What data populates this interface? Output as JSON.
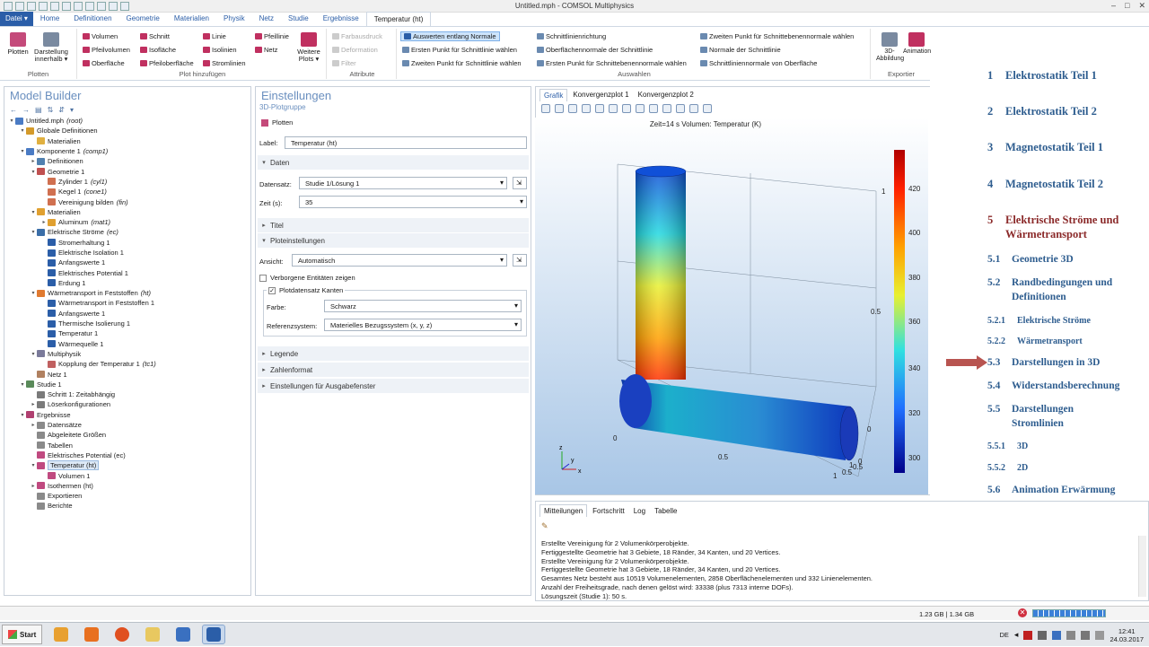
{
  "window": {
    "title": "Untitled.mph - COMSOL Multiphysics"
  },
  "menu": {
    "file": "Datei ▾",
    "tabs": [
      "Home",
      "Definitionen",
      "Geometrie",
      "Materialien",
      "Physik",
      "Netz",
      "Studie",
      "Ergebnisse",
      "Temperatur (ht)"
    ]
  },
  "ribbon": {
    "plot_btn": "Plotten",
    "layout_btn_1": "Darstellung",
    "layout_btn_2": "innerhalb ▾",
    "group_plot": "Plotten",
    "add": {
      "c1": [
        "Volumen",
        "Pfeilvolumen",
        "Oberfläche"
      ],
      "c2": [
        "Schnitt",
        "Isofläche",
        "Pfeiloberfläche"
      ],
      "c3": [
        "Linie",
        "Isolinien",
        "Stromlinien"
      ],
      "c4": [
        "Pfeillinie",
        "Netz"
      ],
      "more_1": "Weitere",
      "more_2": "Plots ▾",
      "label": "Plot hinzufügen"
    },
    "attr": {
      "items": [
        "Farbausdruck",
        "Deformation",
        "Filter"
      ],
      "label": "Attribute"
    },
    "sel": {
      "c1": [
        "Auswerten entlang Normale",
        "Ersten Punkt für Schnittlinie wählen",
        "Zweiten Punkt für Schnittlinie wählen"
      ],
      "c2": [
        "Schnittlinienrichtung",
        "Oberflächennormale der Schnittlinie",
        "Ersten Punkt für Schnittebenennormale wählen"
      ],
      "c3": [
        "Zweiten Punkt für Schnittebenennormale wählen",
        "Normale der Schnittlinie",
        "Schnittliniennormale von Oberfläche"
      ],
      "label": "Auswahlen"
    },
    "export": {
      "b1": "3D-Abbildung",
      "b2": "Animation",
      "label": "Exportier"
    }
  },
  "model_builder": {
    "title": "Model Builder",
    "tree": [
      {
        "d": 0,
        "t": "▾",
        "c": "#4a7bc4",
        "l": "Untitled.mph",
        "i": "(root)"
      },
      {
        "d": 1,
        "t": "▾",
        "c": "#d49a2a",
        "l": "Globale Definitionen"
      },
      {
        "d": 2,
        "t": "",
        "c": "#e0b040",
        "l": "Materialien"
      },
      {
        "d": 1,
        "t": "▾",
        "c": "#4a7bc4",
        "l": "Komponente 1",
        "i": "(comp1)"
      },
      {
        "d": 2,
        "t": "▸",
        "c": "#5080b0",
        "l": "Definitionen"
      },
      {
        "d": 2,
        "t": "▾",
        "c": "#c05050",
        "l": "Geometrie 1"
      },
      {
        "d": 3,
        "t": "",
        "c": "#d07050",
        "l": "Zylinder 1",
        "i": "(cyl1)"
      },
      {
        "d": 3,
        "t": "",
        "c": "#d07050",
        "l": "Kegel 1",
        "i": "(cone1)"
      },
      {
        "d": 3,
        "t": "",
        "c": "#d07050",
        "l": "Vereinigung bilden",
        "i": "(fin)"
      },
      {
        "d": 2,
        "t": "▾",
        "c": "#e0a030",
        "l": "Materialien"
      },
      {
        "d": 3,
        "t": "▸",
        "c": "#e0a030",
        "l": "Aluminum",
        "i": "(mat1)"
      },
      {
        "d": 2,
        "t": "▾",
        "c": "#3a6ea8",
        "l": "Elektrische Ströme",
        "i": "(ec)"
      },
      {
        "d": 3,
        "t": "",
        "c": "#2b5ea8",
        "l": "Stromerhaltung 1"
      },
      {
        "d": 3,
        "t": "",
        "c": "#2b5ea8",
        "l": "Elektrische Isolation 1"
      },
      {
        "d": 3,
        "t": "",
        "c": "#2b5ea8",
        "l": "Anfangswerte 1"
      },
      {
        "d": 3,
        "t": "",
        "c": "#2b5ea8",
        "l": "Elektrisches Potential 1"
      },
      {
        "d": 3,
        "t": "",
        "c": "#2b5ea8",
        "l": "Erdung 1"
      },
      {
        "d": 2,
        "t": "▾",
        "c": "#e07a30",
        "l": "Wärmetransport in Feststoffen",
        "i": "(ht)"
      },
      {
        "d": 3,
        "t": "",
        "c": "#2b5ea8",
        "l": "Wärmetransport in Feststoffen 1"
      },
      {
        "d": 3,
        "t": "",
        "c": "#2b5ea8",
        "l": "Anfangswerte 1"
      },
      {
        "d": 3,
        "t": "",
        "c": "#2b5ea8",
        "l": "Thermische Isolierung 1"
      },
      {
        "d": 3,
        "t": "",
        "c": "#2b5ea8",
        "l": "Temperatur 1"
      },
      {
        "d": 3,
        "t": "",
        "c": "#2b5ea8",
        "l": "Wärmequelle 1"
      },
      {
        "d": 2,
        "t": "▾",
        "c": "#7a7a9a",
        "l": "Multiphysik"
      },
      {
        "d": 3,
        "t": "",
        "c": "#c06060",
        "l": "Kopplung der Temperatur 1",
        "i": "(tc1)"
      },
      {
        "d": 2,
        "t": "",
        "c": "#b08060",
        "l": "Netz 1"
      },
      {
        "d": 1,
        "t": "▾",
        "c": "#5a8a5a",
        "l": "Studie 1"
      },
      {
        "d": 2,
        "t": "",
        "c": "#7a7a7a",
        "l": "Schritt 1: Zeitabhängig"
      },
      {
        "d": 2,
        "t": "▸",
        "c": "#7a7a7a",
        "l": "Löserkonfigurationen"
      },
      {
        "d": 1,
        "t": "▾",
        "c": "#b04070",
        "l": "Ergebnisse"
      },
      {
        "d": 2,
        "t": "▸",
        "c": "#8a8a8a",
        "l": "Datensätze"
      },
      {
        "d": 2,
        "t": "",
        "c": "#8a8a8a",
        "l": "Abgeleitete Größen"
      },
      {
        "d": 2,
        "t": "",
        "c": "#8a8a8a",
        "l": "Tabellen"
      },
      {
        "d": 2,
        "t": "",
        "c": "#c04a80",
        "l": "Elektrisches Potential (ec)"
      },
      {
        "d": 2,
        "t": "▾",
        "c": "#c04a80",
        "l": "Temperatur (ht)",
        "sel": true
      },
      {
        "d": 3,
        "t": "",
        "c": "#c04a80",
        "l": "Volumen 1"
      },
      {
        "d": 2,
        "t": "▸",
        "c": "#c04a80",
        "l": "Isothermen (ht)"
      },
      {
        "d": 2,
        "t": "",
        "c": "#8a8a8a",
        "l": "Exportieren"
      },
      {
        "d": 2,
        "t": "",
        "c": "#8a8a8a",
        "l": "Berichte"
      }
    ]
  },
  "settings": {
    "title": "Einstellungen",
    "subtitle": "3D-Plotgruppe",
    "plot_btn": "Plotten",
    "label_caption": "Label:",
    "label_value": "Temperatur (ht)",
    "sec_daten": "Daten",
    "dataset_caption": "Datensatz:",
    "dataset_value": "Studie 1/Lösung 1",
    "time_caption": "Zeit (s):",
    "time_value": "35",
    "sec_titel": "Titel",
    "sec_plot": "Ploteinstellungen",
    "view_caption": "Ansicht:",
    "view_value": "Automatisch",
    "hidden_label": "Verborgene Entitäten zeigen",
    "frame_label": "Plotdatensatz Kanten",
    "color_caption": "Farbe:",
    "color_value": "Schwarz",
    "ref_caption": "Referenzsystem:",
    "ref_value": "Materielles Bezugssystem  (x, y, z)",
    "sec_legende": "Legende",
    "sec_zahl": "Zahlenformat",
    "sec_ausgabe": "Einstellungen für Ausgabefenster"
  },
  "graphics": {
    "tabs": [
      "Grafik",
      "Konvergenzplot 1",
      "Konvergenzplot 2"
    ],
    "plot_title": "Zeit=14 s    Volumen: Temperatur (K)",
    "colorbar_ticks": [
      "420",
      "400",
      "380",
      "360",
      "340",
      "320",
      "300"
    ],
    "axis_labels": [
      "1",
      "0.5",
      "0",
      "0",
      "0.5",
      "1",
      "0.5",
      "0.5",
      "0",
      "1"
    ],
    "axes_triad": [
      "z",
      "y",
      "x"
    ]
  },
  "messages": {
    "tabs": [
      "Mitteilungen",
      "Fortschritt",
      "Log",
      "Tabelle"
    ],
    "lines": [
      "Erstellte Vereinigung für 2 Volumenkörperobjekte.",
      "Fertiggestellte Geometrie hat 3 Gebiete, 18 Ränder, 34 Kanten, und 20 Vertices.",
      "Erstellte Vereinigung für 2 Volumenkörperobjekte.",
      "Fertiggestellte Geometrie hat 3 Gebiete, 18 Ränder, 34 Kanten, und 20 Vertices.",
      "Gesamtes Netz besteht aus 10519 Volumenelementen, 2858 Oberflächenelementen und 332 Linienelementen.",
      "Anzahl der Freiheitsgrade, nach denen gelöst wird: 33338 (plus 7313 interne DOFs).",
      "Lösungszeit (Studie 1): 50 s."
    ]
  },
  "toc": [
    {
      "n": "1",
      "l": "Elektrostatik Teil 1",
      "lvl": 1
    },
    {
      "n": "2",
      "l": "Elektrostatik Teil 2",
      "lvl": 1
    },
    {
      "n": "3",
      "l": "Magnetostatik Teil 1",
      "lvl": 1
    },
    {
      "n": "4",
      "l": "Magnetostatik Teil 2",
      "lvl": 1
    },
    {
      "n": "5",
      "l": "Elektrische Ströme und",
      "l2": "Wärmetransport",
      "lvl": 1,
      "red": true
    },
    {
      "n": "5.1",
      "l": "Geometrie 3D",
      "lvl": 2
    },
    {
      "n": "5.2",
      "l": "Randbedingungen und",
      "l2": "Definitionen",
      "lvl": 2
    },
    {
      "n": "5.2.1",
      "l": "Elektrische Ströme",
      "lvl": 3
    },
    {
      "n": "5.2.2",
      "l": "Wärmetransport",
      "lvl": 3
    },
    {
      "n": "5.3",
      "l": "Darstellungen in 3D",
      "lvl": 2
    },
    {
      "n": "5.4",
      "l": "Widerstandsberechnung",
      "lvl": 2
    },
    {
      "n": "5.5",
      "l": "Darstellungen",
      "l2": "Stromlinien",
      "lvl": 2
    },
    {
      "n": "5.5.1",
      "l": "3D",
      "lvl": 3
    },
    {
      "n": "5.5.2",
      "l": "2D",
      "lvl": 3
    },
    {
      "n": "5.6",
      "l": "Animation Erwärmung",
      "lvl": 2
    }
  ],
  "status": {
    "memory": "1.23 GB | 1.34 GB"
  },
  "taskbar": {
    "start": "Start",
    "lang": "DE",
    "time": "12:41",
    "date": "24.03.2017"
  },
  "colors": {
    "accent": "#2b5ea8",
    "toc_blue": "#2e5d8f",
    "toc_red": "#8b2a2a",
    "arrow": "#b85450"
  }
}
